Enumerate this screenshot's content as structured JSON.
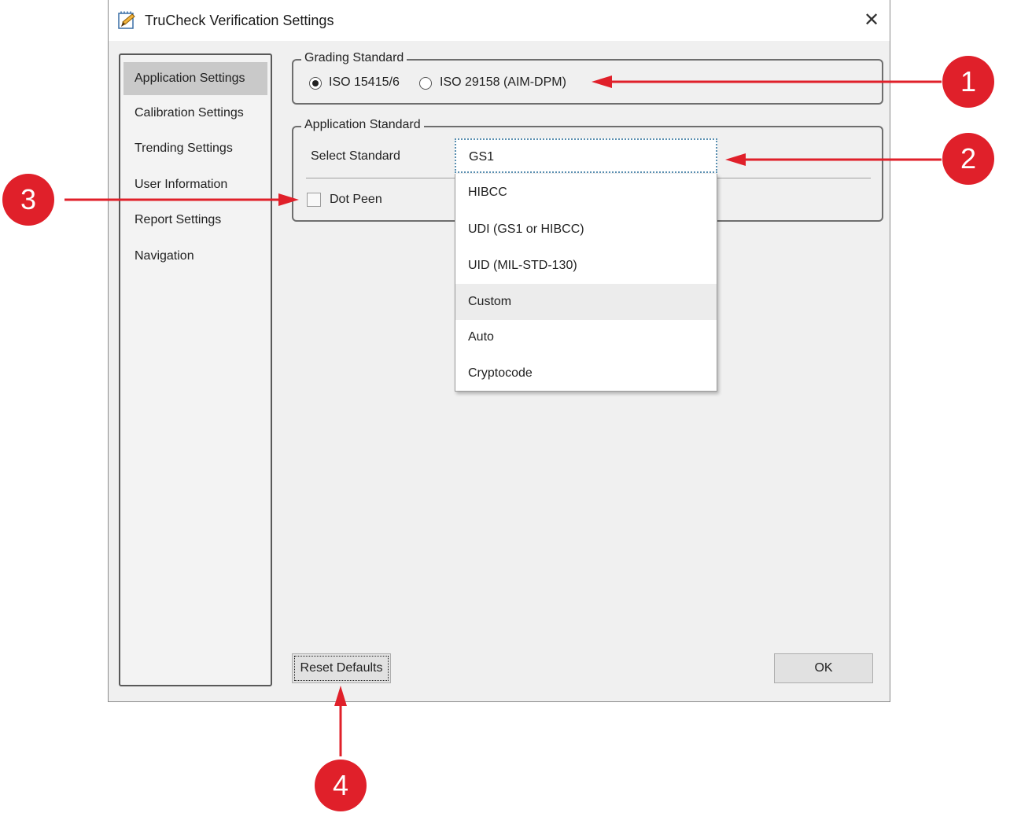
{
  "window": {
    "title": "TruCheck Verification Settings",
    "close_glyph": "✕"
  },
  "sidebar": {
    "items": [
      {
        "label": "Application Settings",
        "active": true
      },
      {
        "label": "Calibration Settings"
      },
      {
        "label": "Trending Settings"
      },
      {
        "label": "User Information"
      },
      {
        "label": "Report Settings"
      },
      {
        "label": "Navigation"
      }
    ]
  },
  "grading": {
    "legend": "Grading Standard",
    "options": [
      {
        "label": "ISO 15415/6",
        "checked": true
      },
      {
        "label": "ISO 29158 (AIM-DPM)",
        "checked": false
      }
    ]
  },
  "application": {
    "legend": "Application Standard",
    "select_label": "Select Standard",
    "selected": "GS1",
    "options": [
      "HIBCC",
      "UDI (GS1 or HIBCC)",
      "UID (MIL-STD-130)",
      "Custom",
      "Auto",
      "Cryptocode"
    ],
    "dot_peen_label": "Dot Peen"
  },
  "buttons": {
    "reset_defaults": "Reset Defaults",
    "ok": "OK"
  },
  "callouts": [
    "1",
    "2",
    "3",
    "4"
  ],
  "colors": {
    "callout_red": "#e0202a",
    "window_bg": "#f0f0f0"
  }
}
